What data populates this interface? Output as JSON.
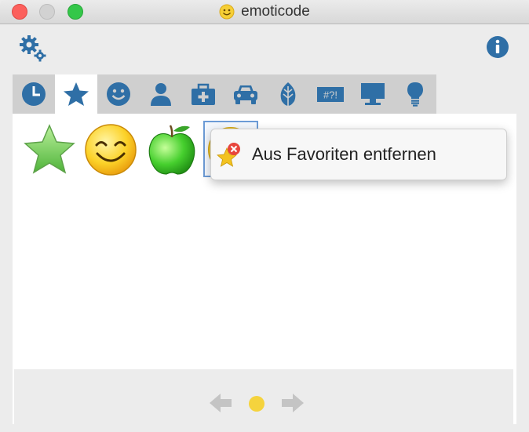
{
  "window": {
    "title": "emoticode"
  },
  "toolbar": {
    "settings_icon": "gear-icon",
    "info_icon": "info-icon"
  },
  "tabs": [
    {
      "icon": "clock-icon",
      "active": false
    },
    {
      "icon": "star-icon",
      "active": true
    },
    {
      "icon": "smiley-icon",
      "active": false
    },
    {
      "icon": "person-icon",
      "active": false
    },
    {
      "icon": "medical-kit-icon",
      "active": false
    },
    {
      "icon": "car-icon",
      "active": false
    },
    {
      "icon": "leaf-icon",
      "active": false
    },
    {
      "icon": "symbols-icon",
      "active": false
    },
    {
      "icon": "monitor-icon",
      "active": false
    },
    {
      "icon": "lightbulb-icon",
      "active": false
    }
  ],
  "symbols_tab_text": "#?!",
  "favorites": [
    {
      "icon": "green-star-icon"
    },
    {
      "icon": "smiling-face-icon"
    },
    {
      "icon": "green-apple-icon"
    },
    {
      "icon": "yellow-emoji-icon",
      "selected": true
    }
  ],
  "context_menu": {
    "item_label": "Aus Favoriten entfernen",
    "item_icon": "remove-favorite-icon"
  },
  "pager": {
    "current_page": 1,
    "page_count": 1,
    "dot_color": "#f5d33d"
  },
  "colors": {
    "tab_icon": "#2f6fa6",
    "accent_selection": "#6c9bd6"
  }
}
